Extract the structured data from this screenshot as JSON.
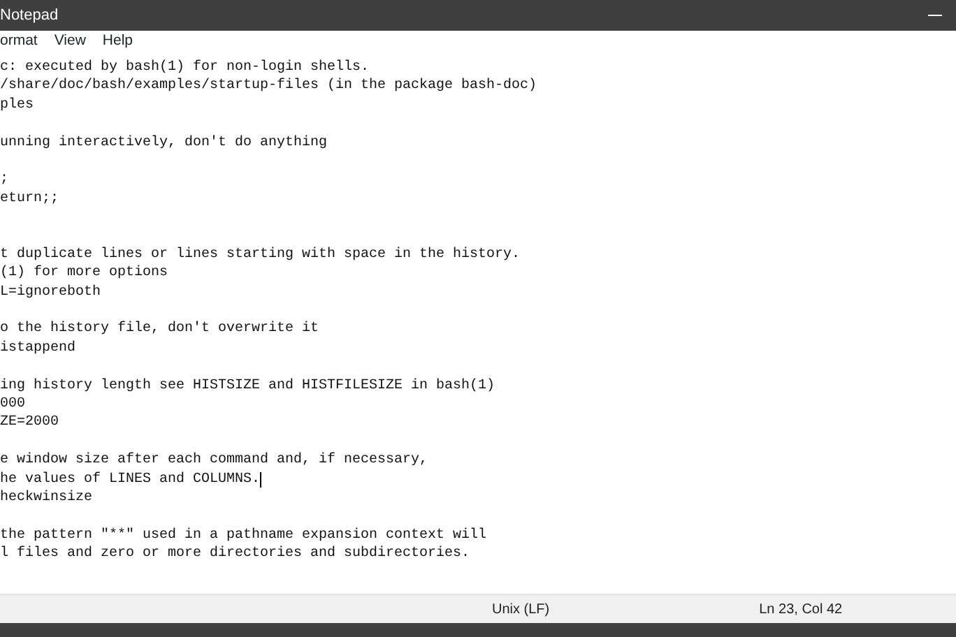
{
  "window": {
    "title": "Notepad"
  },
  "menu": [
    "ormat",
    "View",
    "Help"
  ],
  "lines": [
    {
      "kind": "text",
      "text": "c: executed by bash(1) for non-login shells."
    },
    {
      "kind": "text",
      "text": "/share/doc/bash/examples/startup-files (in the package bash-doc)"
    },
    {
      "kind": "text",
      "text": "ples"
    },
    {
      "kind": "blank"
    },
    {
      "kind": "text",
      "text": "unning interactively, don't do anything"
    },
    {
      "kind": "blank"
    },
    {
      "kind": "text",
      "text": ";"
    },
    {
      "kind": "text",
      "text": "eturn;;"
    },
    {
      "kind": "blank"
    },
    {
      "kind": "blank"
    },
    {
      "kind": "text",
      "text": "t duplicate lines or lines starting with space in the history."
    },
    {
      "kind": "text",
      "text": "(1) for more options"
    },
    {
      "kind": "text",
      "text": "L=ignoreboth"
    },
    {
      "kind": "blank"
    },
    {
      "kind": "text",
      "text": "o the history file, don't overwrite it"
    },
    {
      "kind": "text",
      "text": "istappend"
    },
    {
      "kind": "blank"
    },
    {
      "kind": "text",
      "text": "ing history length see HISTSIZE and HISTFILESIZE in bash(1)"
    },
    {
      "kind": "text",
      "text": "000"
    },
    {
      "kind": "text",
      "text": "ZE=2000"
    },
    {
      "kind": "blank"
    },
    {
      "kind": "text",
      "text": "e window size after each command and, if necessary,"
    },
    {
      "kind": "text",
      "text": "he values of LINES and COLUMNS.",
      "caret": true
    },
    {
      "kind": "text",
      "text": "heckwinsize"
    },
    {
      "kind": "blank"
    },
    {
      "kind": "text",
      "text": "the pattern \"**\" used in a pathname expansion context will"
    },
    {
      "kind": "text",
      "text": "l files and zero or more directories and subdirectories."
    }
  ],
  "status_bar": {
    "line_ending": "Unix (LF)",
    "position": "Ln 23, Col 42"
  }
}
